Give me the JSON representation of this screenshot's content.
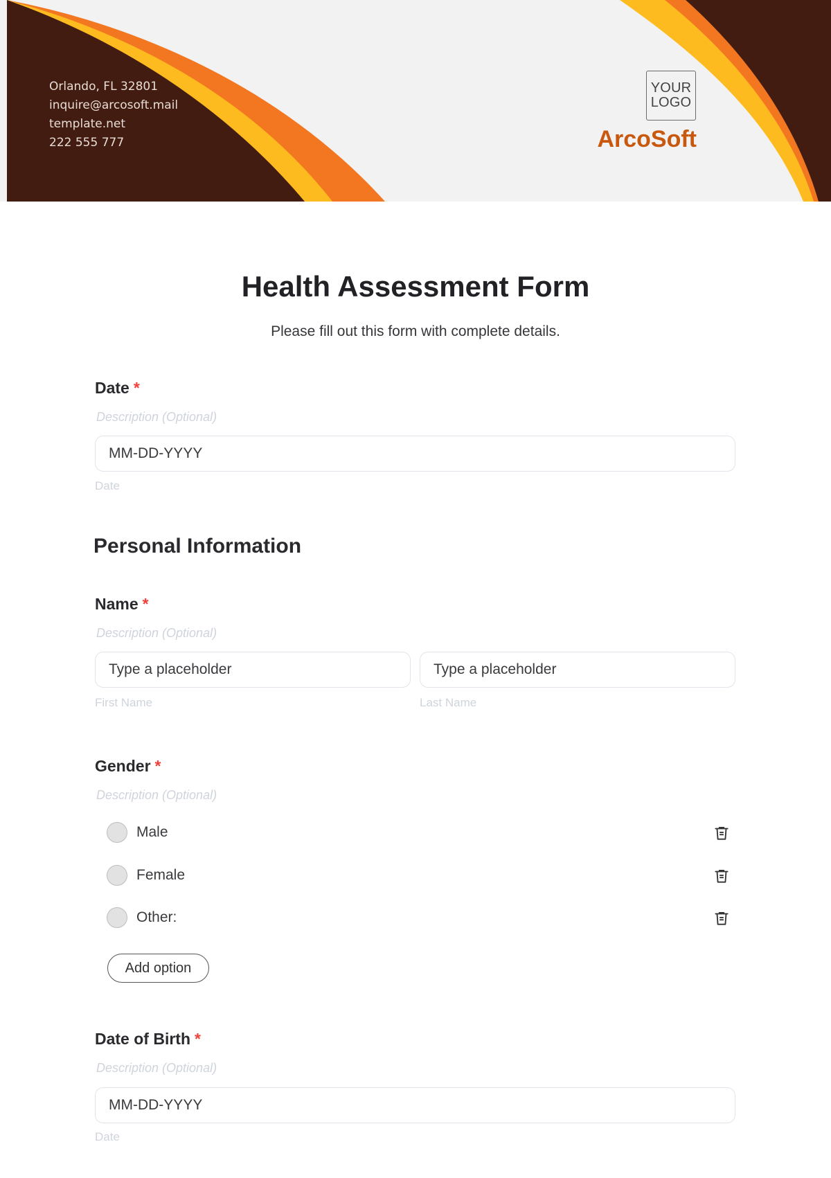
{
  "header": {
    "contact": {
      "address": "Orlando, FL 32801",
      "email": "inquire@arcosoft.mail",
      "website": "template.net",
      "phone": "222 555 777"
    },
    "logo_line1": "YOUR",
    "logo_line2": "LOGO",
    "brand": "ArcoSoft",
    "colors": {
      "dark_brown": "#421c10",
      "orange": "#f37721",
      "yellow": "#fdbb20",
      "brand_text": "#c9580f"
    }
  },
  "form": {
    "title": "Health Assessment Form",
    "subtitle": "Please fill out this form with complete details.",
    "required_marker": "*",
    "date_field": {
      "label": "Date",
      "description": "Description (Optional)",
      "value": "MM-DD-YYYY",
      "caption": "Date"
    },
    "section_personal": "Personal Information",
    "name_field": {
      "label": "Name",
      "description": "Description (Optional)",
      "first_placeholder": "Type a placeholder",
      "first_caption": "First Name",
      "last_placeholder": "Type a placeholder",
      "last_caption": "Last Name"
    },
    "gender_field": {
      "label": "Gender",
      "description": "Description (Optional)",
      "options": [
        {
          "label": "Male"
        },
        {
          "label": "Female"
        },
        {
          "label": "Other:"
        }
      ],
      "add_option_label": "Add option"
    },
    "dob_field": {
      "label": "Date of Birth",
      "description": "Description (Optional)",
      "value": "MM-DD-YYYY",
      "caption": "Date"
    }
  }
}
